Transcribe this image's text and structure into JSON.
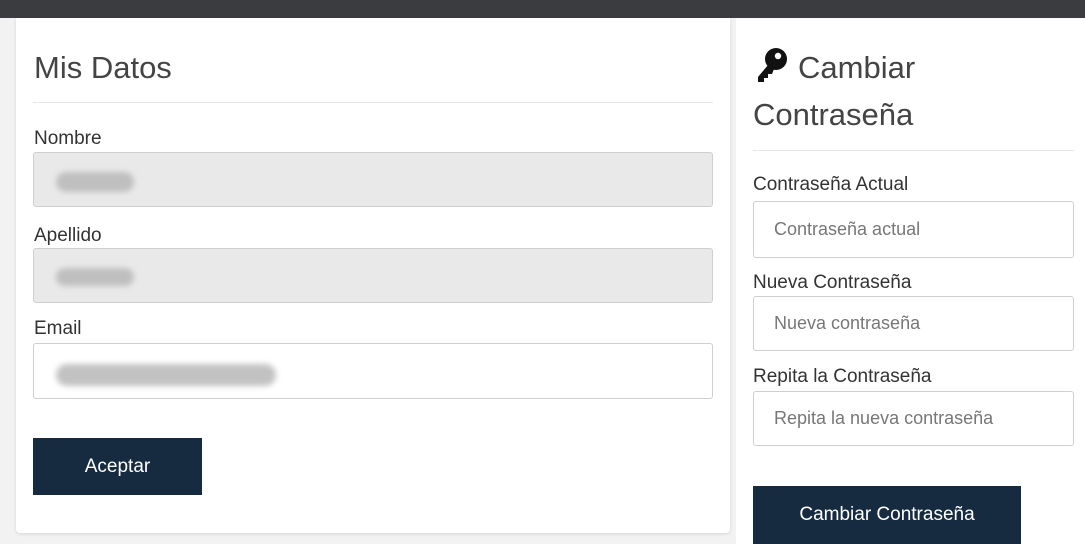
{
  "left_card": {
    "title": "Mis Datos",
    "fields": [
      {
        "label": "Nombre",
        "value": "",
        "disabled": true
      },
      {
        "label": "Apellido",
        "value": "",
        "disabled": true
      },
      {
        "label": "Email",
        "value": "",
        "disabled": false
      }
    ],
    "submit_label": "Aceptar"
  },
  "right_card": {
    "icon": "key-icon",
    "title_line1": "Cambiar",
    "title_line2": "Contraseña",
    "fields": [
      {
        "label": "Contraseña Actual",
        "placeholder": "Contraseña actual"
      },
      {
        "label": "Nueva Contraseña",
        "placeholder": "Nueva contraseña"
      },
      {
        "label": "Repita la Contraseña",
        "placeholder": "Repita la nueva contraseña"
      }
    ],
    "submit_label": "Cambiar Contraseña"
  },
  "colors": {
    "topbar": "#3a3c40",
    "button": "#172b40",
    "disabled_field": "#e9e9e9"
  }
}
